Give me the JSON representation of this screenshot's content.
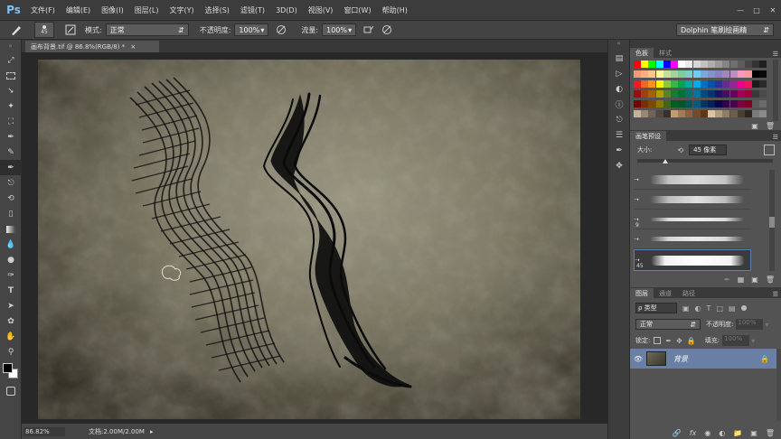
{
  "app": {
    "logo": "Ps"
  },
  "menu": [
    "文件(F)",
    "编辑(E)",
    "图像(I)",
    "图层(L)",
    "文字(Y)",
    "选择(S)",
    "滤镜(T)",
    "3D(D)",
    "视图(V)",
    "窗口(W)",
    "帮助(H)"
  ],
  "options": {
    "brush_size": "45",
    "mode_label": "模式:",
    "mode_value": "正常",
    "opacity_label": "不透明度:",
    "opacity_value": "100%",
    "flow_label": "流量:",
    "flow_value": "100%",
    "workspace": "Dolphin 笔刷绘画精"
  },
  "document": {
    "tab_title": "画布背景.tif @ 86.8%(RGB/8) *",
    "zoom": "86.82%",
    "doc_info": "文档:2.00M/2.00M"
  },
  "swatches_panel": {
    "tab_active": "色板",
    "tab_inactive": "样式",
    "colors": [
      [
        "#ff0000",
        "#ffff00",
        "#00ff00",
        "#00ffff",
        "#0000ff",
        "#ff00ff",
        "#ffffff",
        "#ebebeb",
        "#d6d6d6",
        "#c2c2c2",
        "#adadad",
        "#999999",
        "#858585",
        "#707070",
        "#5c5c5c",
        "#474747",
        "#333333",
        "#1f1f1f"
      ],
      [
        "#f7977a",
        "#f9ad81",
        "#fdc68a",
        "#fff79a",
        "#c4df9b",
        "#a2d39c",
        "#82ca9d",
        "#7bcdc8",
        "#6ecff6",
        "#7ea7d8",
        "#8493ca",
        "#8882be",
        "#a187be",
        "#bc8dbf",
        "#f49ac2",
        "#f6989d",
        "#000000",
        "#0a0a0a"
      ],
      [
        "#ed1c24",
        "#f26522",
        "#f7941d",
        "#fff200",
        "#8dc63f",
        "#39b54a",
        "#00a651",
        "#00a99d",
        "#00aeef",
        "#0072bc",
        "#0054a6",
        "#2e3192",
        "#662d91",
        "#92278f",
        "#ec008c",
        "#ed145b",
        "#1a1a1a",
        "#2a2a2a"
      ],
      [
        "#9e0b0f",
        "#a0410d",
        "#a36209",
        "#aba000",
        "#598527",
        "#1a7b30",
        "#007236",
        "#00746b",
        "#0076a3",
        "#004b80",
        "#003471",
        "#1b1464",
        "#440e62",
        "#630460",
        "#9e005d",
        "#9e0039",
        "#3a3a3a",
        "#4a4a4a"
      ],
      [
        "#790000",
        "#7b2e00",
        "#7d4900",
        "#827b00",
        "#406618",
        "#005e20",
        "#005826",
        "#005952",
        "#005b7f",
        "#003663",
        "#002157",
        "#0d004c",
        "#32004b",
        "#4b0049",
        "#7b0046",
        "#7a0026",
        "#5a5a5a",
        "#6a6a6a"
      ],
      [
        "#c7b299",
        "#998675",
        "#736357",
        "#534741",
        "#37302d",
        "#c69c6d",
        "#a67c52",
        "#8c6239",
        "#754c24",
        "#603913",
        "#d9c2a5",
        "#b39b7d",
        "#8f7d67",
        "#6b5c4c",
        "#4a3f33",
        "#2e261e",
        "#7a7a7a",
        "#8a8a8a"
      ]
    ]
  },
  "brush_panel": {
    "tab": "画笔预设",
    "size_label": "大小:",
    "size_value": "45 像素",
    "presets": [
      {
        "size": ""
      },
      {
        "size": ""
      },
      {
        "size": "9"
      },
      {
        "size": ""
      },
      {
        "size": "45"
      }
    ]
  },
  "layers_panel": {
    "tabs": [
      "图层",
      "通道",
      "路径"
    ],
    "kind_label": "ρ 类型",
    "blend_mode": "正常",
    "opacity_label": "不透明度:",
    "opacity_value": "100%",
    "lock_label": "锁定:",
    "fill_label": "填充:",
    "fill_value": "100%",
    "layer_name": "背景"
  }
}
